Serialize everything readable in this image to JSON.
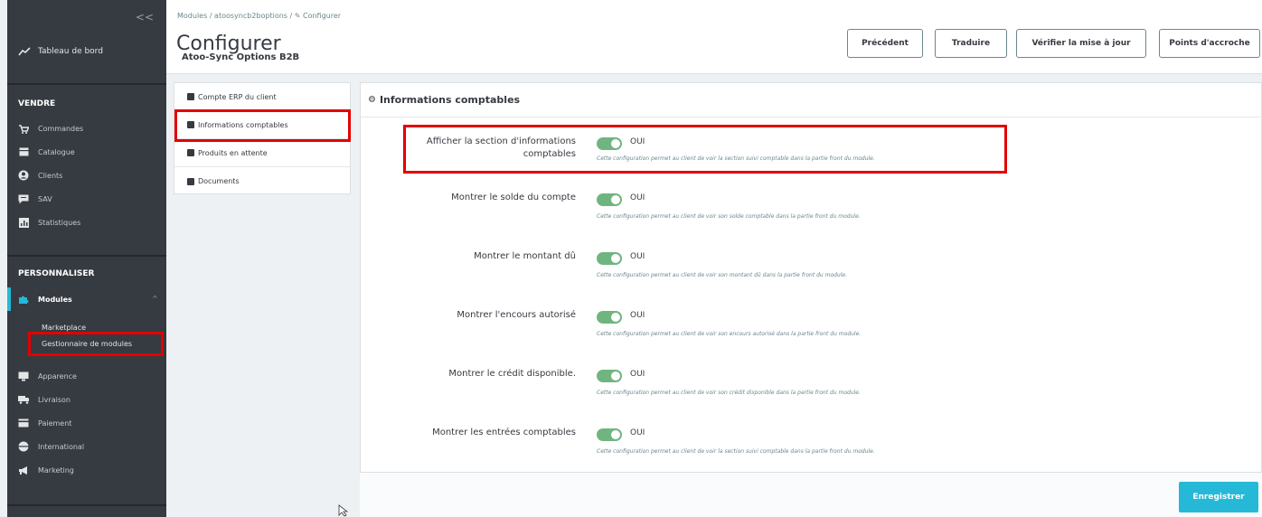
{
  "sidebar": {
    "collapse_label": "<<",
    "dashboard": "Tableau de bord",
    "sections": {
      "vendre": "VENDRE",
      "personnaliser": "PERSONNALISER"
    },
    "vendre_items": [
      "Commandes",
      "Catalogue",
      "Clients",
      "SAV",
      "Statistiques"
    ],
    "modules_label": "Modules",
    "modules_sub": [
      "Marketplace",
      "Gestionnaire de modules"
    ],
    "personnaliser_items": [
      "Apparence",
      "Livraison",
      "Paiement",
      "International",
      "Marketing"
    ]
  },
  "header": {
    "breadcrumb": "Modules  /  atoosyncb2boptions  /  ✎ Configurer",
    "title": "Configurer",
    "subtitle": "Atoo-Sync Options B2B",
    "buttons": [
      "Précédent",
      "Traduire",
      "Vérifier la mise à jour",
      "Points d'accroche"
    ]
  },
  "tabs": [
    "Compte ERP du client",
    "Informations comptables",
    "Produits en attente",
    "Documents"
  ],
  "panel": {
    "title": "Informations comptables",
    "fields": [
      {
        "label": "Afficher la section d'informations comptables",
        "value": "OUI",
        "help": "Cette configuration permet au client de voir la section suivi comptable dans la partie front du module."
      },
      {
        "label": "Montrer le solde du compte",
        "value": "OUI",
        "help": "Cette configuration permet au client de voir son solde comptable dans la partie front du module."
      },
      {
        "label": "Montrer le montant dû",
        "value": "OUI",
        "help": "Cette configuration permet au client de voir son montant dû dans la partie front du module."
      },
      {
        "label": "Montrer l'encours autorisé",
        "value": "OUI",
        "help": "Cette configuration permet au client de voir son encours autorisé dans la partie front du module."
      },
      {
        "label": "Montrer le crédit disponible.",
        "value": "OUI",
        "help": "Cette configuration permet au client de voir son crédit disponible dans la partie front du module."
      },
      {
        "label": "Montrer les entrées comptables",
        "value": "OUI",
        "help": "Cette configuration permet au client de voir la section suivi comptable dans la partie front du module."
      }
    ],
    "save_label": "Enregistrer"
  },
  "colors": {
    "sidebar_bg": "#363a41",
    "accent": "#25b9d7",
    "toggle_on": "#70b580",
    "highlight": "#e30000"
  }
}
